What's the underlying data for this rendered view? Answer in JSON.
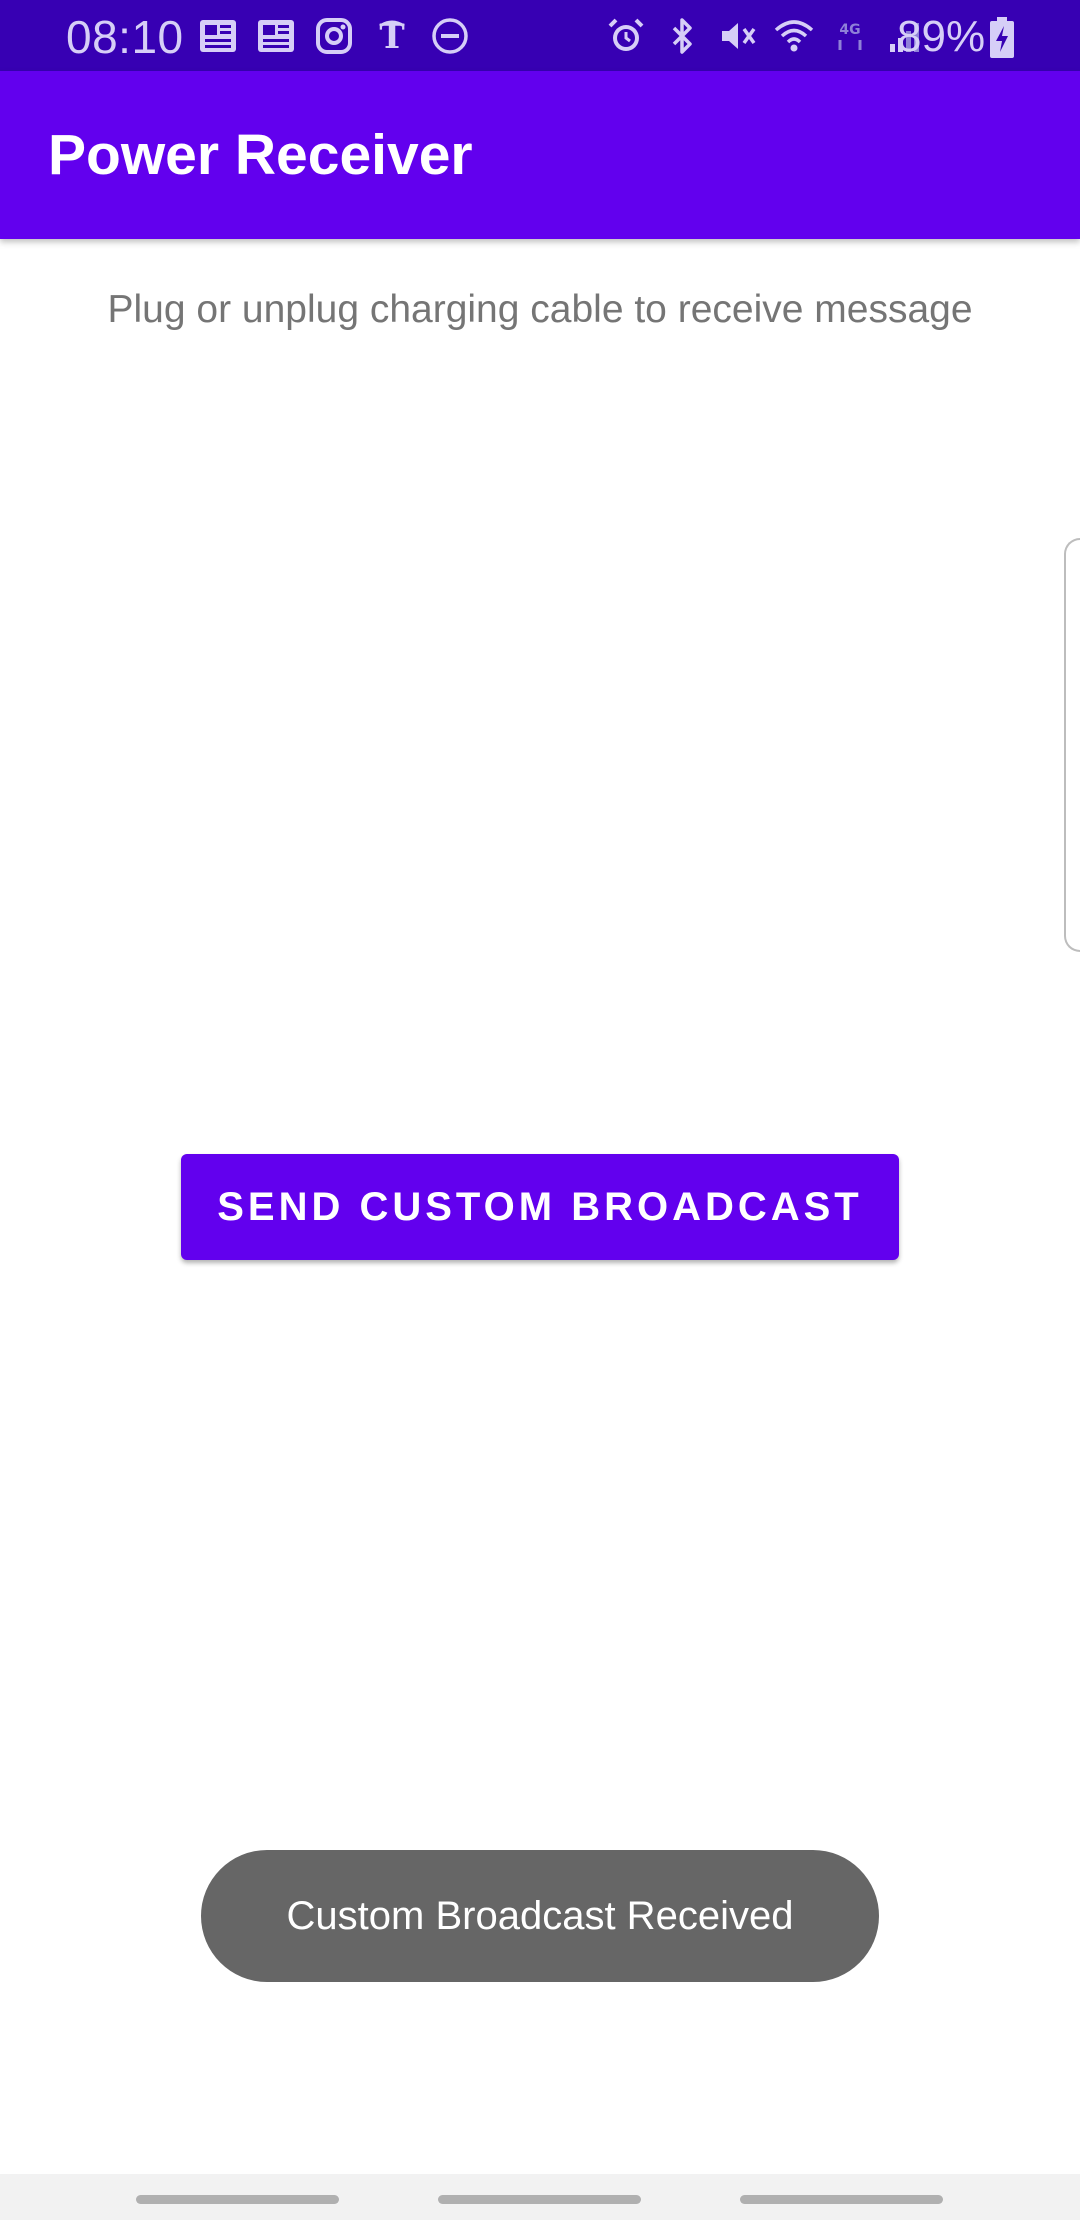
{
  "status_bar": {
    "time": "08:10",
    "battery_percent": "89%",
    "left_icons": [
      "news-icon",
      "news-icon",
      "instagram-icon",
      "nyt-icon",
      "do-not-disturb-icon"
    ],
    "right_icons": [
      "alarm-icon",
      "bluetooth-icon",
      "mute-icon",
      "wifi-icon",
      "lte-icon",
      "signal-icon"
    ]
  },
  "app_bar": {
    "title": "Power Receiver"
  },
  "main": {
    "hint": "Plug or unplug charging cable to receive message",
    "send_button_label": "SEND CUSTOM BROADCAST"
  },
  "toast": {
    "message": "Custom Broadcast Received"
  },
  "colors": {
    "status_bar": "#3700b3",
    "primary": "#6200ee",
    "toast_bg": "#666666"
  }
}
